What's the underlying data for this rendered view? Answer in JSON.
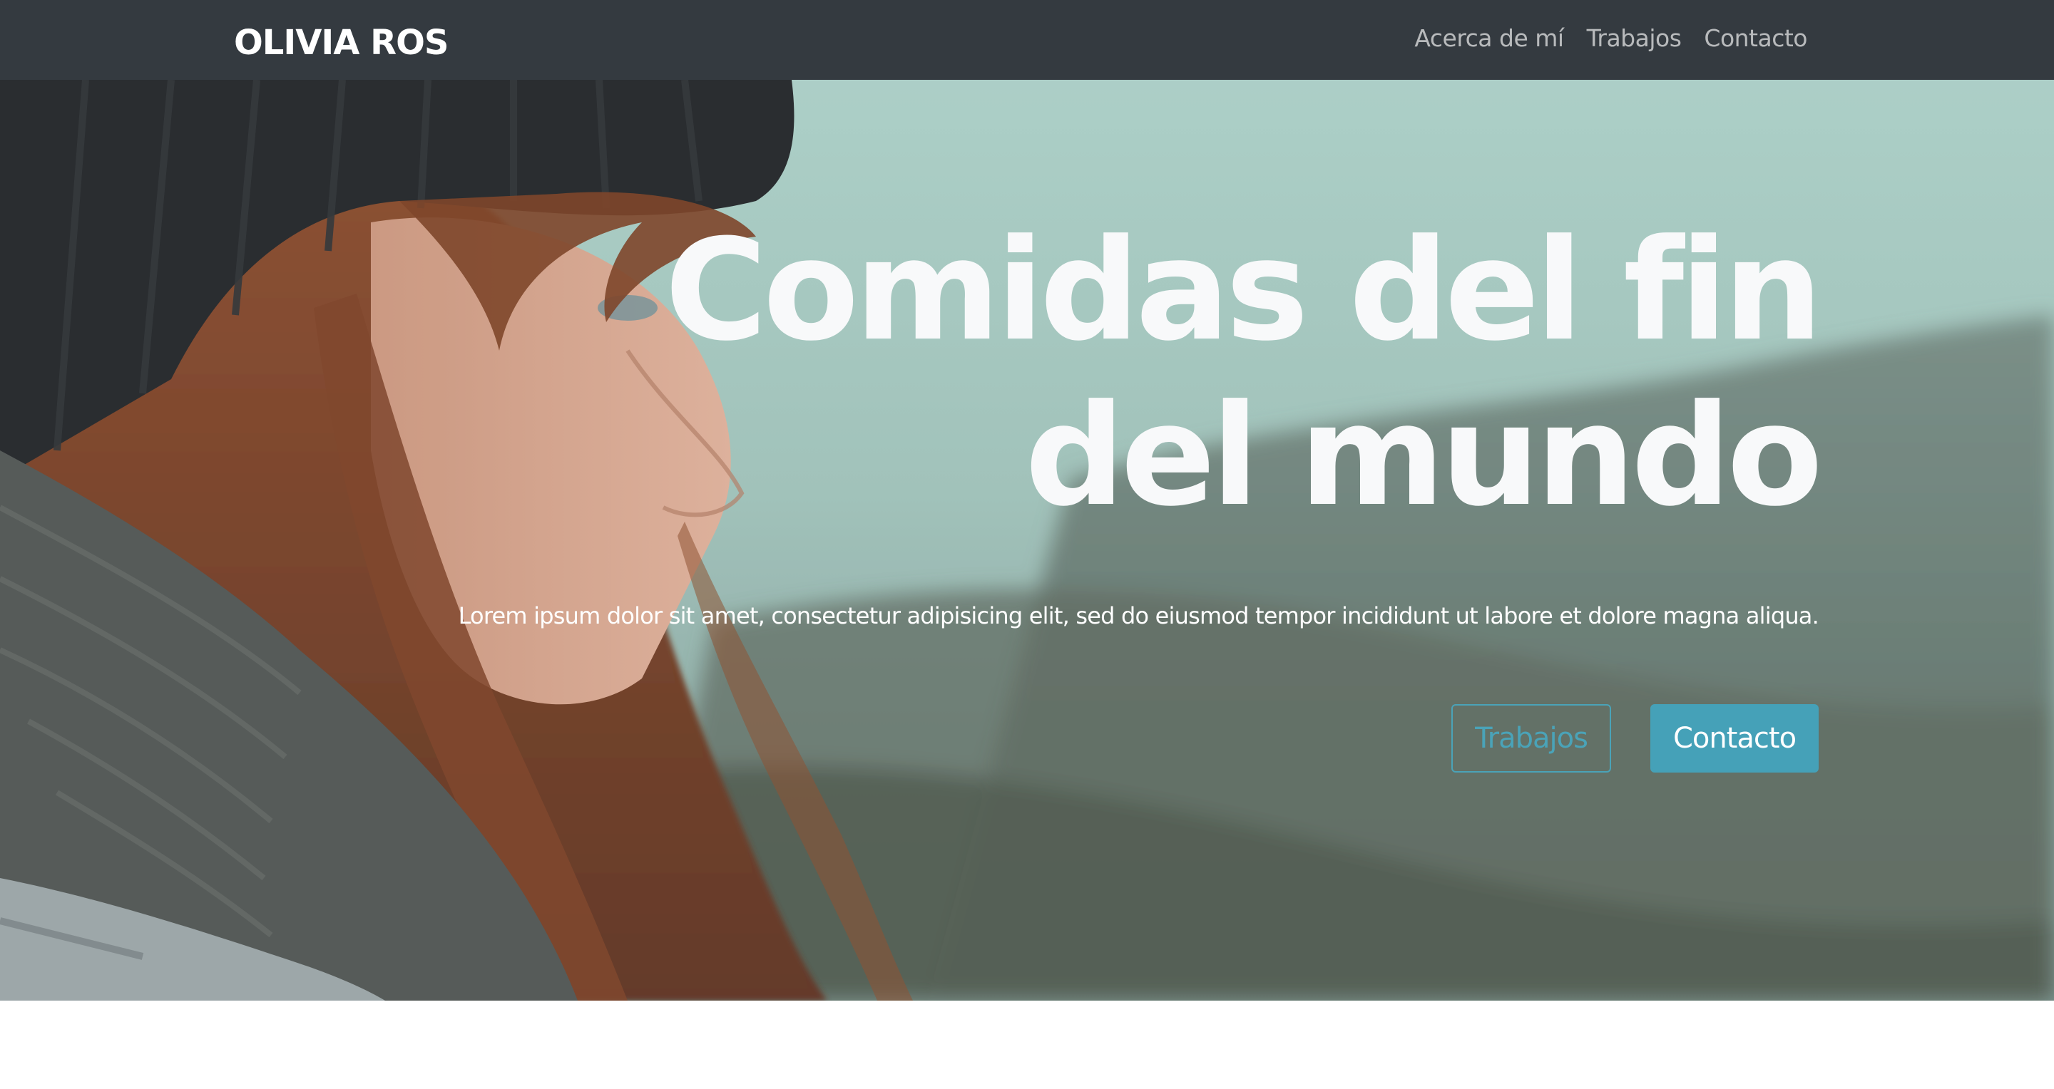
{
  "navbar": {
    "brand": "OLIVIA ROS",
    "links": [
      {
        "label": "Acerca de mí"
      },
      {
        "label": "Trabajos"
      },
      {
        "label": "Contacto"
      }
    ],
    "background": "#343a40"
  },
  "hero": {
    "title": "Comidas del fin del mundo",
    "lead": "Lorem ipsum dolor sit amet, consectetur adipisicing elit, sed do eiusmod tempor incididunt ut labore et dolore magna aliqua.",
    "buttons": {
      "secondary_label": "Trabajos",
      "primary_label": "Contacto"
    },
    "accent_color": "#45a1b8"
  }
}
